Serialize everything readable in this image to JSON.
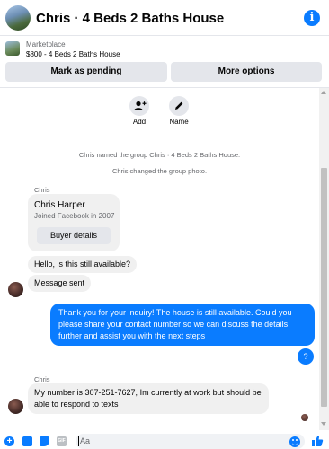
{
  "header": {
    "title": "Chris · 4 Beds 2 Baths House",
    "info_glyph": "i"
  },
  "marketplace": {
    "label": "Marketplace",
    "detail": "$800 - 4 Beds 2 Baths House",
    "mark_pending_label": "Mark as pending",
    "more_options_label": "More options"
  },
  "actions": {
    "add_label": "Add",
    "name_label": "Name"
  },
  "system_messages": [
    "Chris named the group Chris · 4 Beds 2 Baths House.",
    "Chris changed the group photo."
  ],
  "conversation": {
    "sender_name": "Chris",
    "contact_card": {
      "name": "Chris Harper",
      "joined": "Joined Facebook in 2007",
      "button_label": "Buyer details"
    },
    "incoming_1": "Hello, is this still available?",
    "incoming_2": "Message sent",
    "outgoing_1": "Thank you for your inquiry! The house is still available. Could you please share your contact number so we can discuss the details further and assist you with the next steps",
    "outgoing_2": "?",
    "incoming_3": "My number is 307-251-7627, Im currently at work but should be able to respond to texts"
  },
  "composer": {
    "placeholder": "Aa",
    "gif_label": "GIF"
  },
  "colors": {
    "accent": "#0a7cff",
    "bubble_in": "#f0f0f0",
    "text_secondary": "#65676b"
  },
  "icons": [
    "info-icon",
    "add-person-icon",
    "pencil-icon",
    "plus-icon",
    "photo-icon",
    "sticker-icon",
    "gif-icon",
    "emoji-icon",
    "thumbs-up-icon"
  ]
}
